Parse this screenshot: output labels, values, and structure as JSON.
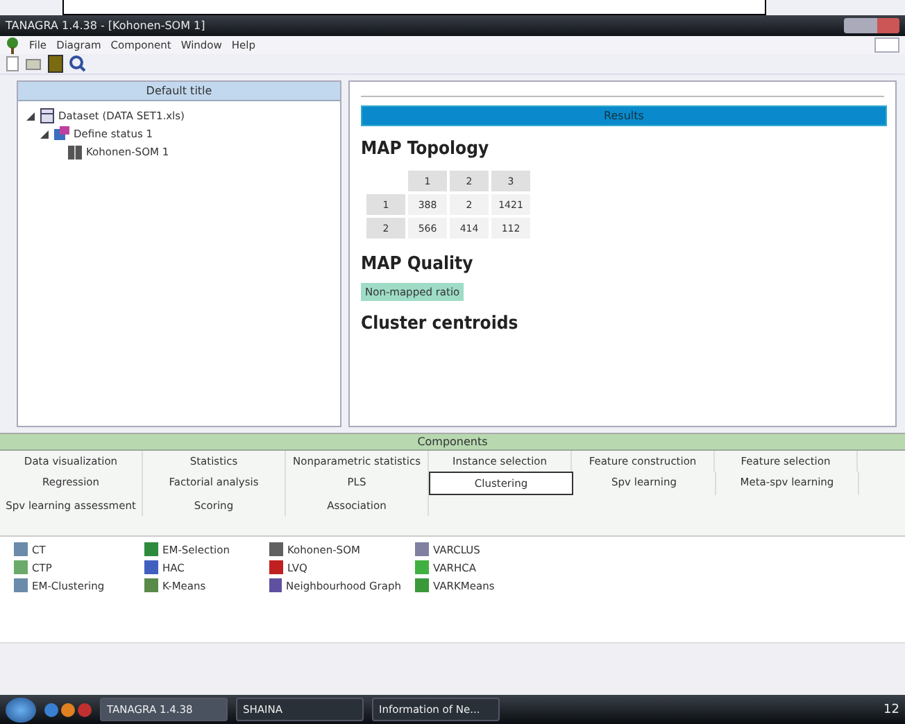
{
  "window": {
    "title": "TANAGRA 1.4.38 - [Kohonen-SOM 1]"
  },
  "menu": [
    "File",
    "Diagram",
    "Component",
    "Window",
    "Help"
  ],
  "diagram": {
    "title": "Default title",
    "tree": [
      {
        "label": "Dataset (DATA SET1.xls)",
        "kind": "dataset",
        "expanded": true,
        "children": [
          {
            "label": "Define status 1",
            "kind": "status",
            "expanded": true,
            "children": [
              {
                "label": "Kohonen-SOM 1",
                "kind": "som"
              }
            ]
          }
        ]
      }
    ]
  },
  "results": {
    "banner": "Results",
    "topology_heading": "MAP Topology",
    "topology_columns": [
      "1",
      "2",
      "3"
    ],
    "topology_rows": [
      {
        "head": "1",
        "cells": [
          "388",
          "2",
          "1421"
        ]
      },
      {
        "head": "2",
        "cells": [
          "566",
          "414",
          "112"
        ]
      }
    ],
    "quality_heading": "MAP Quality",
    "quality_tag": "Non-mapped ratio",
    "centroids_heading": "Cluster centroids"
  },
  "components": {
    "title": "Components",
    "tab_rows": [
      [
        {
          "label": "Data visualization",
          "selected": false
        },
        {
          "label": "Statistics",
          "selected": false
        },
        {
          "label": "Nonparametric statistics",
          "selected": false
        },
        {
          "label": "Instance selection",
          "selected": false
        },
        {
          "label": "Feature construction",
          "selected": false
        },
        {
          "label": "Feature selection",
          "selected": false
        }
      ],
      [
        {
          "label": "Regression",
          "selected": false
        },
        {
          "label": "Factorial analysis",
          "selected": false
        },
        {
          "label": "PLS",
          "selected": false
        },
        {
          "label": "Clustering",
          "selected": true
        },
        {
          "label": "Spv learning",
          "selected": false
        },
        {
          "label": "Meta-spv learning",
          "selected": false
        }
      ],
      [
        {
          "label": "Spv learning assessment",
          "selected": false
        },
        {
          "label": "Scoring",
          "selected": false
        },
        {
          "label": "Association",
          "selected": false
        }
      ]
    ],
    "items": [
      [
        {
          "label": "CT",
          "color": "#6a8caa"
        },
        {
          "label": "CTP",
          "color": "#6aaa6a"
        },
        {
          "label": "EM-Clustering",
          "color": "#6a8caa"
        }
      ],
      [
        {
          "label": "EM-Selection",
          "color": "#2e8b3e"
        },
        {
          "label": "HAC",
          "color": "#4060c0"
        },
        {
          "label": "K-Means",
          "color": "#5a8a4a"
        }
      ],
      [
        {
          "label": "Kohonen-SOM",
          "color": "#606060"
        },
        {
          "label": "LVQ",
          "color": "#c02020"
        },
        {
          "label": "Neighbourhood Graph",
          "color": "#6050a0"
        }
      ],
      [
        {
          "label": "VARCLUS",
          "color": "#8080a0"
        },
        {
          "label": "VARHCA",
          "color": "#40b040"
        },
        {
          "label": "VARKMeans",
          "color": "#3a9a3a"
        }
      ]
    ]
  },
  "taskbar": {
    "buttons": [
      {
        "label": "TANAGRA 1.4.38",
        "selected": true
      },
      {
        "label": "SHAINA",
        "selected": false
      },
      {
        "label": "Information of Ne...",
        "selected": false
      }
    ],
    "clock": "12"
  }
}
